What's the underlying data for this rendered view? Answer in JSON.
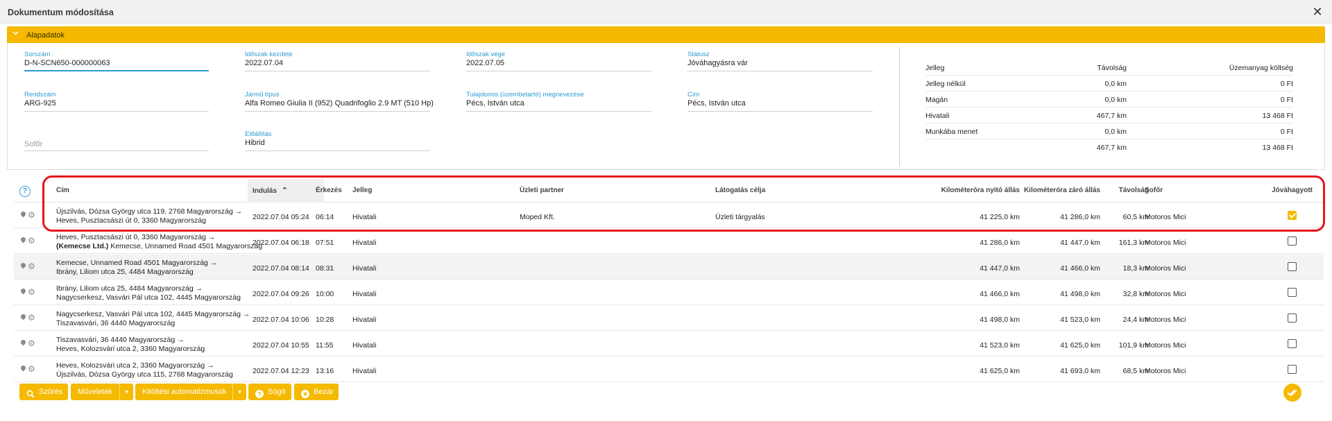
{
  "window": {
    "title": "Dokumentum módosítása",
    "close_glyph": "✕"
  },
  "section": {
    "title": "Alapadatok"
  },
  "form": {
    "sorszam": {
      "label": "Sorszám",
      "value": "D-N-SCN650-000000063"
    },
    "idoszak_kezdete": {
      "label": "Időszak kezdete",
      "value": "2022.07.04"
    },
    "idoszak_vege": {
      "label": "Időszak vége",
      "value": "2022.07.05"
    },
    "statusz": {
      "label": "Státusz",
      "value": "Jóváhagyásra vár"
    },
    "rendszam": {
      "label": "Rendszám",
      "value": "ARG-925"
    },
    "jarmu_tipus": {
      "label": "Jármű típus",
      "value": "Alfa Romeo Giulia II (952) Quadrifoglio 2.9 MT (510 Hp)"
    },
    "tulajdonos": {
      "label": "Tulajdonos (üzembetartó) megnevezése",
      "value": "Pécs, István utca"
    },
    "cim": {
      "label": "Cím",
      "value": "Pécs, István utca"
    },
    "sofor": {
      "placeholder": "Sofőr"
    },
    "elohajtas": {
      "label": "Előállítás",
      "value": "Hibrid"
    }
  },
  "summary": {
    "headers": {
      "jelleg": "Jelleg",
      "tavolsag": "Távolság",
      "koltseg": "Üzemanyag költség"
    },
    "rows": [
      {
        "jelleg": "Jelleg nélkül",
        "tavolsag": "0,0 km",
        "koltseg": "0 Ft"
      },
      {
        "jelleg": "Magán",
        "tavolsag": "0,0 km",
        "koltseg": "0 Ft"
      },
      {
        "jelleg": "Hivatali",
        "tavolsag": "467,7 km",
        "koltseg": "13 468 Ft"
      },
      {
        "jelleg": "Munkába menet",
        "tavolsag": "0,0 km",
        "koltseg": "0 Ft"
      }
    ],
    "total": {
      "tavolsag": "467,7 km",
      "koltseg": "13 468 Ft"
    }
  },
  "table": {
    "help_glyph": "?",
    "headers": {
      "cim": "Cím",
      "indulas": "Indulás",
      "erkezes": "Érkezés",
      "jelleg": "Jelleg",
      "partner": "Üzleti partner",
      "celja": "Látogatás célja",
      "nyito": "Kilométeróra nyitó állás",
      "zaro": "Kilométeróra záró állás",
      "tavolsag": "Távolság",
      "sofor": "Sofőr",
      "jovahagyott": "Jóváhagyott"
    },
    "sort_glyph": "⌃",
    "rows": [
      {
        "from_prefix": "",
        "from": "Újszilvás, Dózsa György utca 119, 2768 Magyarország →",
        "to_prefix": "",
        "to": "Heves, Pusztacsászi út 0, 3360 Magyarország",
        "indulas": "2022.07.04 05:24",
        "erkezes": "06:14",
        "jelleg": "Hivatali",
        "partner": "Moped Kft.",
        "celja": "Üzleti tárgyalás",
        "nyito": "41 225,0 km",
        "zaro": "41 286,0 km",
        "tavolsag": "60,5 km",
        "sofor": "Motoros Mici",
        "approved": true
      },
      {
        "from_prefix": "",
        "from": "Heves, Pusztacsászi út 0, 3360 Magyarország →",
        "to_prefix": "(Kemecse Ltd.)",
        "to": " Kemecse, Unnamed Road 4501 Magyarország",
        "indulas": "2022.07.04 06:18",
        "erkezes": "07:51",
        "jelleg": "Hivatali",
        "partner": "",
        "celja": "",
        "nyito": "41 286,0 km",
        "zaro": "41 447,0 km",
        "tavolsag": "161,3 km",
        "sofor": "Motoros Mici",
        "approved": false
      },
      {
        "from_prefix": "",
        "from": "Kemecse, Unnamed Road 4501 Magyarország →",
        "to_prefix": "",
        "to": "Ibrány, Liliom utca 25, 4484 Magyarország",
        "indulas": "2022.07.04 08:14",
        "erkezes": "08:31",
        "jelleg": "Hivatali",
        "partner": "",
        "celja": "",
        "nyito": "41 447,0 km",
        "zaro": "41 466,0 km",
        "tavolsag": "18,3 km",
        "sofor": "Motoros Mici",
        "approved": false
      },
      {
        "from_prefix": "",
        "from": "Ibrány, Liliom utca 25, 4484 Magyarország →",
        "to_prefix": "",
        "to": "Nagycserkesz, Vasvári Pál utca 102, 4445 Magyarország",
        "indulas": "2022.07.04 09:26",
        "erkezes": "10:00",
        "jelleg": "Hivatali",
        "partner": "",
        "celja": "",
        "nyito": "41 466,0 km",
        "zaro": "41 498,0 km",
        "tavolsag": "32,8 km",
        "sofor": "Motoros Mici",
        "approved": false
      },
      {
        "from_prefix": "",
        "from": "Nagycserkesz, Vasvári Pál utca 102, 4445 Magyarország →",
        "to_prefix": "",
        "to": "Tiszavasvári, 36 4440 Magyarország",
        "indulas": "2022.07.04 10:06",
        "erkezes": "10:28",
        "jelleg": "Hivatali",
        "partner": "",
        "celja": "",
        "nyito": "41 498,0 km",
        "zaro": "41 523,0 km",
        "tavolsag": "24,4 km",
        "sofor": "Motoros Mici",
        "approved": false
      },
      {
        "from_prefix": "",
        "from": "Tiszavasvári, 36 4440 Magyarország →",
        "to_prefix": "",
        "to": "Heves, Kolozsvári utca 2, 3360 Magyarország",
        "indulas": "2022.07.04 10:55",
        "erkezes": "11:55",
        "jelleg": "Hivatali",
        "partner": "",
        "celja": "",
        "nyito": "41 523,0 km",
        "zaro": "41 625,0 km",
        "tavolsag": "101,9 km",
        "sofor": "Motoros Mici",
        "approved": false
      },
      {
        "from_prefix": "",
        "from": "Heves, Kolozsvári utca 2, 3360 Magyarország →",
        "to_prefix": "",
        "to": "Újszilvás, Dózsa György utca 115, 2768 Magyarország",
        "indulas": "2022.07.04 12:23",
        "erkezes": "13:16",
        "jelleg": "Hivatali",
        "partner": "",
        "celja": "",
        "nyito": "41 625,0 km",
        "zaro": "41 693,0 km",
        "tavolsag": "68,5 km",
        "sofor": "Motoros Mici",
        "approved": false
      }
    ]
  },
  "toolbar": {
    "szures": "Szűrés",
    "muveletek": "Műveletek",
    "kitoltesi": "Kitöltési automatizmusok",
    "sugo": "Súgó",
    "bezar": "Bezár",
    "dropdown_glyph": "▾"
  },
  "colors": {
    "accent": "#f5b900",
    "label_blue": "#2d9ad3",
    "highlight_red": "#e8141b"
  }
}
